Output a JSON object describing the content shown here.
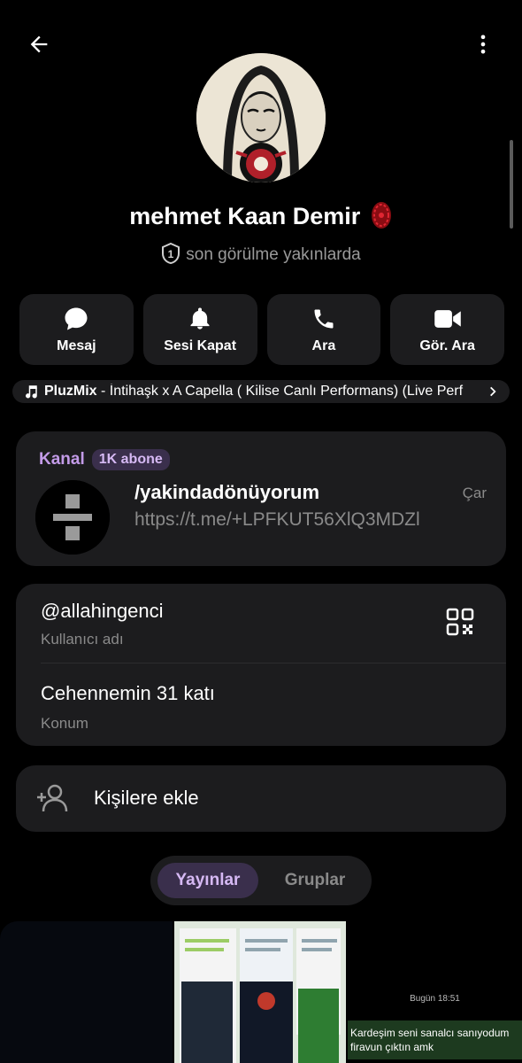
{
  "profile": {
    "name": "mehmet Kaan Demir",
    "status": "son görülme yakınlarda"
  },
  "actions": [
    {
      "label": "Mesaj",
      "icon": "chat-bubble-icon"
    },
    {
      "label": "Sesi Kapat",
      "icon": "bell-icon"
    },
    {
      "label": "Ara",
      "icon": "phone-icon"
    },
    {
      "label": "Gör. Ara",
      "icon": "video-camera-icon"
    }
  ],
  "music": {
    "artist": "PluzMix",
    "track": " - İntihaşk x A Capella ( Kilise Canlı Performans) (Live Perf"
  },
  "channel": {
    "label": "Kanal",
    "subscribers": "1K abone",
    "title": "/yakindadönüyorum",
    "link": "https://t.me/+LPFKUT56XlQ3MDZl",
    "day": "Çar"
  },
  "info": {
    "username": "@allahingenci",
    "username_label": "Kullanıcı adı",
    "location": "Cehennemin 31 katı",
    "location_label": "Konum"
  },
  "add_contact": {
    "label": "Kişilere ekle"
  },
  "tabs": [
    {
      "label": "Yayınlar",
      "active": true
    },
    {
      "label": "Gruplar",
      "active": false
    }
  ],
  "media": {
    "thumb3_time": "Bugün 18:51",
    "thumb3_message": "Kardeşim seni sanalcı sanıyodum firavun çıktın amk"
  },
  "colors": {
    "accent": "#c39be8",
    "card_bg": "#1c1c1e",
    "background": "#000000"
  }
}
